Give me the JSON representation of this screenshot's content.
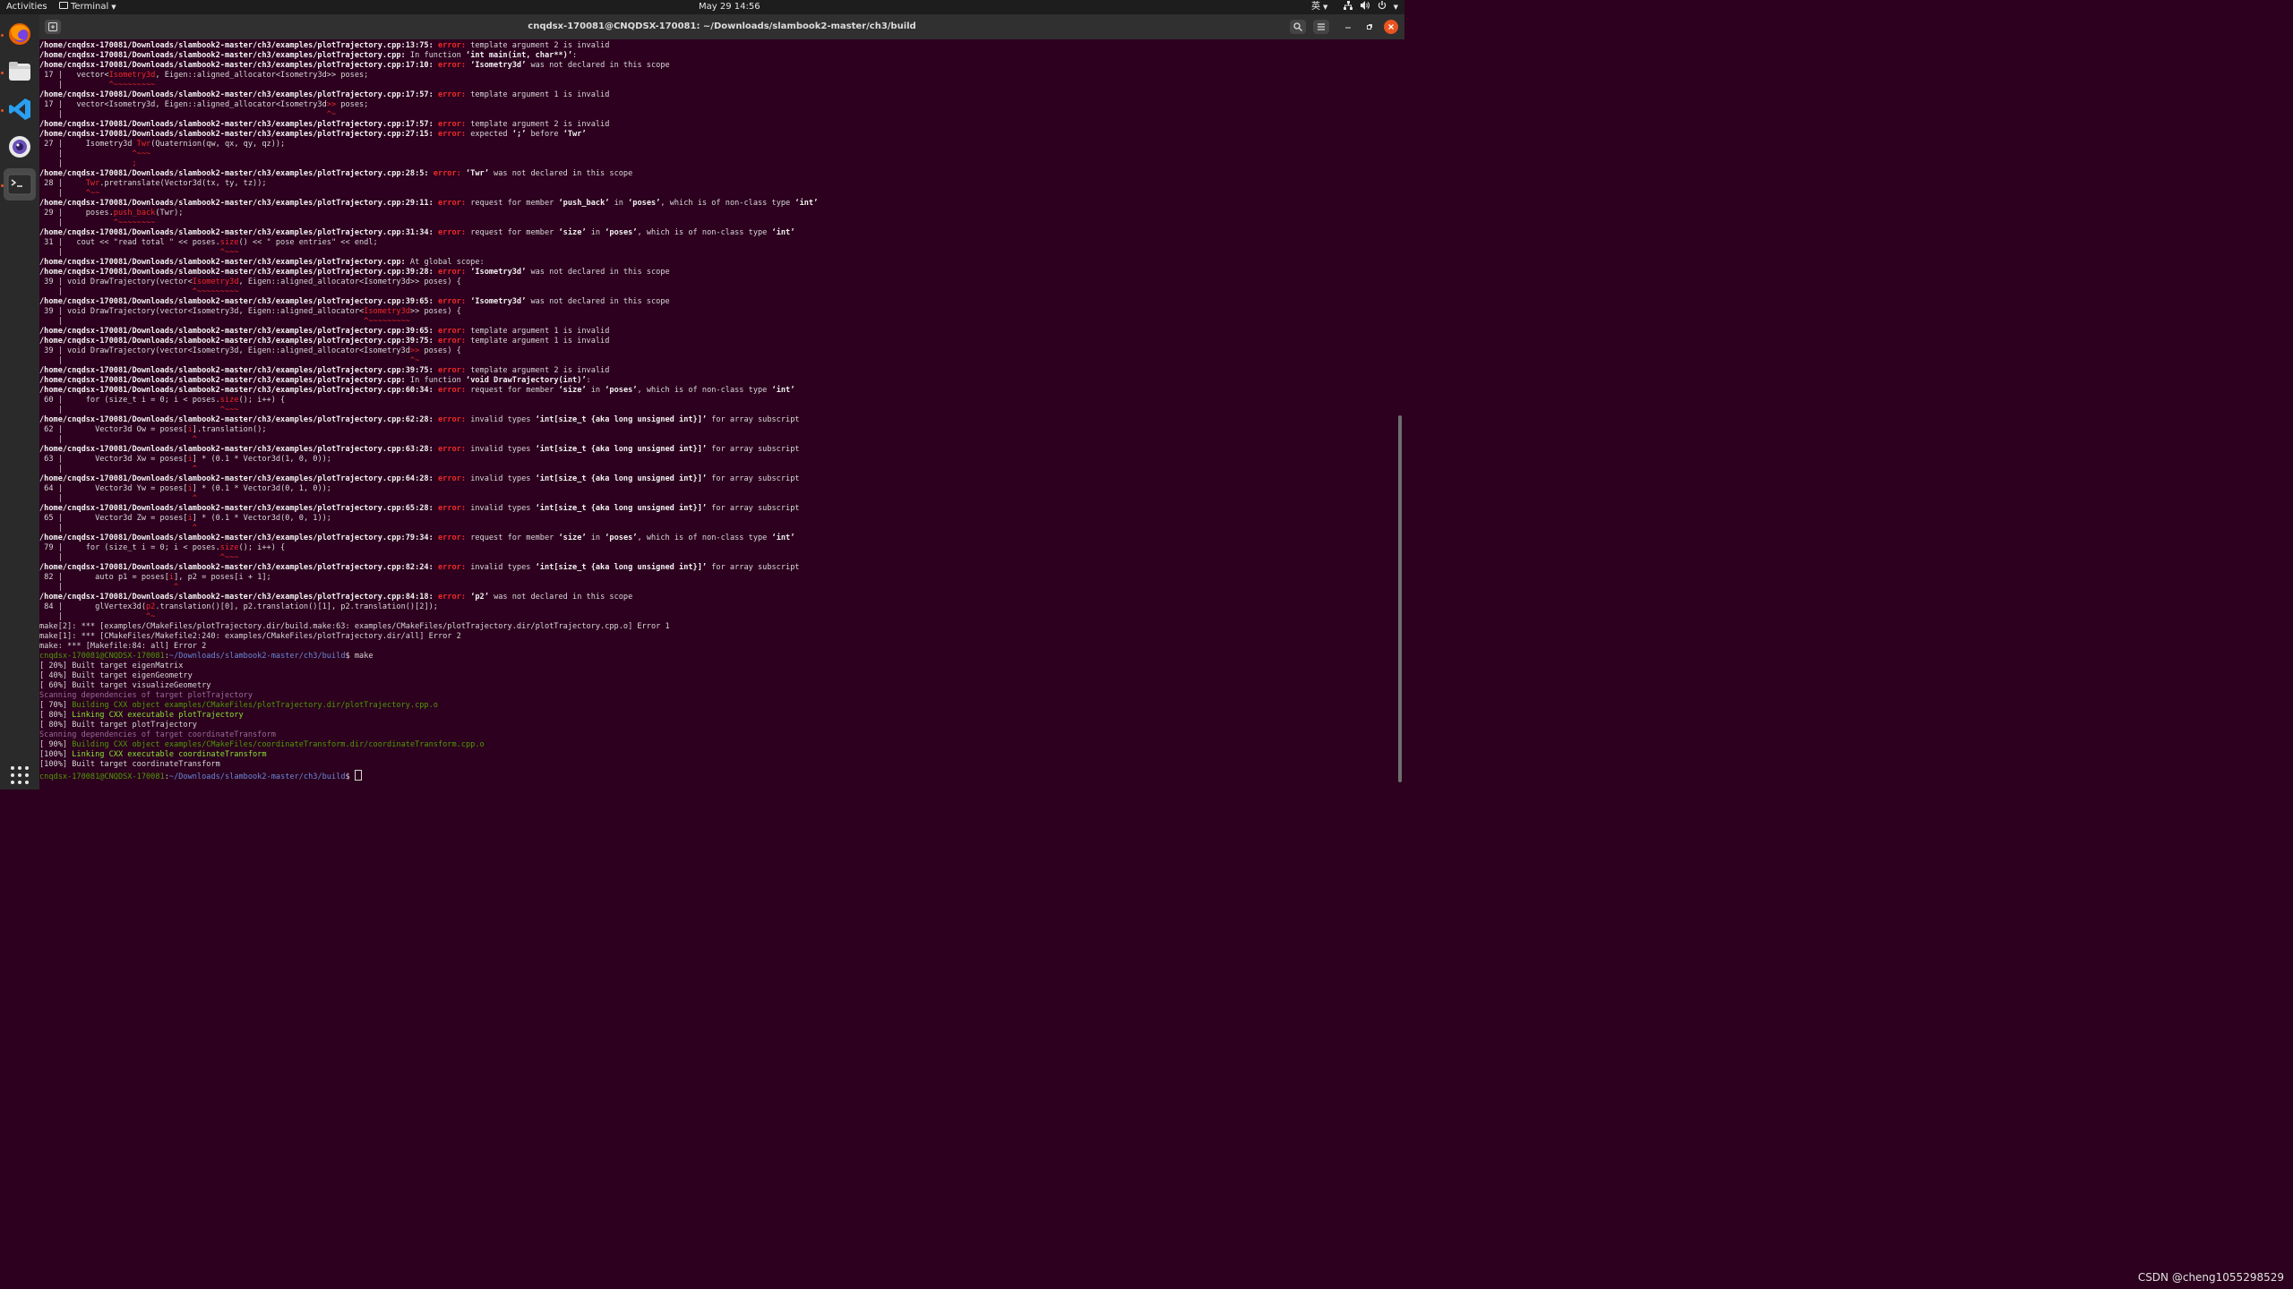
{
  "topbar": {
    "activities": "Activities",
    "app_menu": "Terminal",
    "clock": "May 29  14:56",
    "input_method": "英"
  },
  "dock": {
    "items": [
      {
        "name": "firefox-icon"
      },
      {
        "name": "files-icon"
      },
      {
        "name": "vscode-icon"
      },
      {
        "name": "camera-icon"
      },
      {
        "name": "terminal-icon"
      }
    ]
  },
  "window": {
    "title": "cnqdsx-170081@CNQDSX-170081: ~/Downloads/slambook2-master/ch3/build"
  },
  "colors": {
    "error": "#ef2929",
    "prompt_user": "#4e9a06",
    "prompt_path": "#6a8ad8",
    "build_green": "#8ae234",
    "scanning": "#9a6a9a",
    "background": "#2c001e"
  },
  "terminal": {
    "lines": [
      [
        [
          "b",
          "/home/cnqdsx-170081/Downloads/slambook2-master/ch3/examples/plotTrajectory.cpp:13:75: "
        ],
        [
          "err",
          "error: "
        ],
        [
          "",
          "template argument 2 is invalid"
        ]
      ],
      [
        [
          "b",
          "/home/cnqdsx-170081/Downloads/slambook2-master/ch3/examples/plotTrajectory.cpp:"
        ],
        [
          "",
          " In function "
        ],
        [
          "b",
          "‘int main(int, char**)’"
        ],
        [
          "",
          ":"
        ]
      ],
      [
        [
          "b",
          "/home/cnqdsx-170081/Downloads/slambook2-master/ch3/examples/plotTrajectory.cpp:17:10: "
        ],
        [
          "err",
          "error: "
        ],
        [
          "b",
          "‘Isometry3d’"
        ],
        [
          "",
          " was not declared in this scope"
        ]
      ],
      [
        [
          "",
          " 17 |   vector<"
        ],
        [
          "red",
          "Isometry3d"
        ],
        [
          "",
          ", Eigen::aligned_allocator<Isometry3d>> poses;"
        ]
      ],
      [
        [
          "",
          "    |          "
        ],
        [
          "red",
          "^~~~~~~~~~"
        ]
      ],
      [
        [
          "b",
          "/home/cnqdsx-170081/Downloads/slambook2-master/ch3/examples/plotTrajectory.cpp:17:57: "
        ],
        [
          "err",
          "error: "
        ],
        [
          "",
          "template argument 1 is invalid"
        ]
      ],
      [
        [
          "",
          " 17 |   vector<Isometry3d, Eigen::aligned_allocator<Isometry3d"
        ],
        [
          "red",
          ">>"
        ],
        [
          "",
          " poses;"
        ]
      ],
      [
        [
          "",
          "    |                                                         "
        ],
        [
          "red",
          "^~"
        ]
      ],
      [
        [
          "b",
          "/home/cnqdsx-170081/Downloads/slambook2-master/ch3/examples/plotTrajectory.cpp:17:57: "
        ],
        [
          "err",
          "error: "
        ],
        [
          "",
          "template argument 2 is invalid"
        ]
      ],
      [
        [
          "b",
          "/home/cnqdsx-170081/Downloads/slambook2-master/ch3/examples/plotTrajectory.cpp:27:15: "
        ],
        [
          "err",
          "error: "
        ],
        [
          "",
          "expected "
        ],
        [
          "b",
          "‘;’"
        ],
        [
          "",
          " before "
        ],
        [
          "b",
          "‘Twr’"
        ]
      ],
      [
        [
          "",
          " 27 |     Isometry3d "
        ],
        [
          "red",
          "Twr"
        ],
        [
          "",
          "(Quaternion(qw, qx, qy, qz));"
        ]
      ],
      [
        [
          "",
          "    |               "
        ],
        [
          "red",
          "^~~~"
        ]
      ],
      [
        [
          "",
          "    |               "
        ],
        [
          "red",
          ";"
        ]
      ],
      [
        [
          "b",
          "/home/cnqdsx-170081/Downloads/slambook2-master/ch3/examples/plotTrajectory.cpp:28:5: "
        ],
        [
          "err",
          "error: "
        ],
        [
          "b",
          "‘Twr’"
        ],
        [
          "",
          " was not declared in this scope"
        ]
      ],
      [
        [
          "",
          " 28 |     "
        ],
        [
          "red",
          "Twr"
        ],
        [
          "",
          ".pretranslate(Vector3d(tx, ty, tz));"
        ]
      ],
      [
        [
          "",
          "    |     "
        ],
        [
          "red",
          "^~~"
        ]
      ],
      [
        [
          "b",
          "/home/cnqdsx-170081/Downloads/slambook2-master/ch3/examples/plotTrajectory.cpp:29:11: "
        ],
        [
          "err",
          "error: "
        ],
        [
          "",
          "request for member "
        ],
        [
          "b",
          "‘push_back’"
        ],
        [
          "",
          " in "
        ],
        [
          "b",
          "‘poses’"
        ],
        [
          "",
          ", which is of non-class type "
        ],
        [
          "b",
          "‘int’"
        ]
      ],
      [
        [
          "",
          " 29 |     poses."
        ],
        [
          "red",
          "push_back"
        ],
        [
          "",
          "(Twr);"
        ]
      ],
      [
        [
          "",
          "    |           "
        ],
        [
          "red",
          "^~~~~~~~~"
        ]
      ],
      [
        [
          "b",
          "/home/cnqdsx-170081/Downloads/slambook2-master/ch3/examples/plotTrajectory.cpp:31:34: "
        ],
        [
          "err",
          "error: "
        ],
        [
          "",
          "request for member "
        ],
        [
          "b",
          "‘size’"
        ],
        [
          "",
          " in "
        ],
        [
          "b",
          "‘poses’"
        ],
        [
          "",
          ", which is of non-class type "
        ],
        [
          "b",
          "‘int’"
        ]
      ],
      [
        [
          "",
          " 31 |   cout << \"read total \" << poses."
        ],
        [
          "red",
          "size"
        ],
        [
          "",
          "() << \" pose entries\" << endl;"
        ]
      ],
      [
        [
          "",
          "    |                                  "
        ],
        [
          "red",
          "^~~~"
        ]
      ],
      [
        [
          "b",
          "/home/cnqdsx-170081/Downloads/slambook2-master/ch3/examples/plotTrajectory.cpp:"
        ],
        [
          "",
          " At global scope:"
        ]
      ],
      [
        [
          "b",
          "/home/cnqdsx-170081/Downloads/slambook2-master/ch3/examples/plotTrajectory.cpp:39:28: "
        ],
        [
          "err",
          "error: "
        ],
        [
          "b",
          "‘Isometry3d’"
        ],
        [
          "",
          " was not declared in this scope"
        ]
      ],
      [
        [
          "",
          " 39 | void DrawTrajectory(vector<"
        ],
        [
          "red",
          "Isometry3d"
        ],
        [
          "",
          ", Eigen::aligned_allocator<Isometry3d>> poses) {"
        ]
      ],
      [
        [
          "",
          "    |                            "
        ],
        [
          "red",
          "^~~~~~~~~~"
        ]
      ],
      [
        [
          "b",
          "/home/cnqdsx-170081/Downloads/slambook2-master/ch3/examples/plotTrajectory.cpp:39:65: "
        ],
        [
          "err",
          "error: "
        ],
        [
          "b",
          "‘Isometry3d’"
        ],
        [
          "",
          " was not declared in this scope"
        ]
      ],
      [
        [
          "",
          " 39 | void DrawTrajectory(vector<Isometry3d, Eigen::aligned_allocator<"
        ],
        [
          "red",
          "Isometry3d"
        ],
        [
          "",
          ">> poses) {"
        ]
      ],
      [
        [
          "",
          "    |                                                                 "
        ],
        [
          "red",
          "^~~~~~~~~~"
        ]
      ],
      [
        [
          "b",
          "/home/cnqdsx-170081/Downloads/slambook2-master/ch3/examples/plotTrajectory.cpp:39:65: "
        ],
        [
          "err",
          "error: "
        ],
        [
          "",
          "template argument 1 is invalid"
        ]
      ],
      [
        [
          "b",
          "/home/cnqdsx-170081/Downloads/slambook2-master/ch3/examples/plotTrajectory.cpp:39:75: "
        ],
        [
          "err",
          "error: "
        ],
        [
          "",
          "template argument 1 is invalid"
        ]
      ],
      [
        [
          "",
          " 39 | void DrawTrajectory(vector<Isometry3d, Eigen::aligned_allocator<Isometry3d"
        ],
        [
          "red",
          ">>"
        ],
        [
          "",
          " poses) {"
        ]
      ],
      [
        [
          "",
          "    |                                                                           "
        ],
        [
          "red",
          "^~"
        ]
      ],
      [
        [
          "b",
          "/home/cnqdsx-170081/Downloads/slambook2-master/ch3/examples/plotTrajectory.cpp:39:75: "
        ],
        [
          "err",
          "error: "
        ],
        [
          "",
          "template argument 2 is invalid"
        ]
      ],
      [
        [
          "b",
          "/home/cnqdsx-170081/Downloads/slambook2-master/ch3/examples/plotTrajectory.cpp:"
        ],
        [
          "",
          " In function "
        ],
        [
          "b",
          "‘void DrawTrajectory(int)’"
        ],
        [
          "",
          ":"
        ]
      ],
      [
        [
          "b",
          "/home/cnqdsx-170081/Downloads/slambook2-master/ch3/examples/plotTrajectory.cpp:60:34: "
        ],
        [
          "err",
          "error: "
        ],
        [
          "",
          "request for member "
        ],
        [
          "b",
          "‘size’"
        ],
        [
          "",
          " in "
        ],
        [
          "b",
          "‘poses’"
        ],
        [
          "",
          ", which is of non-class type "
        ],
        [
          "b",
          "‘int’"
        ]
      ],
      [
        [
          "",
          " 60 |     for (size_t i = 0; i < poses."
        ],
        [
          "red",
          "size"
        ],
        [
          "",
          "(); i++) {"
        ]
      ],
      [
        [
          "",
          "    |                                  "
        ],
        [
          "red",
          "^~~~"
        ]
      ],
      [
        [
          "b",
          "/home/cnqdsx-170081/Downloads/slambook2-master/ch3/examples/plotTrajectory.cpp:62:28: "
        ],
        [
          "err",
          "error: "
        ],
        [
          "",
          "invalid types "
        ],
        [
          "b",
          "‘int[size_t {aka long unsigned int}]’"
        ],
        [
          "",
          " for array subscript"
        ]
      ],
      [
        [
          "",
          " 62 |       Vector3d Ow = poses["
        ],
        [
          "red",
          "i"
        ],
        [
          "",
          "].translation();"
        ]
      ],
      [
        [
          "",
          "    |                            "
        ],
        [
          "red",
          "^"
        ]
      ],
      [
        [
          "b",
          "/home/cnqdsx-170081/Downloads/slambook2-master/ch3/examples/plotTrajectory.cpp:63:28: "
        ],
        [
          "err",
          "error: "
        ],
        [
          "",
          "invalid types "
        ],
        [
          "b",
          "‘int[size_t {aka long unsigned int}]’"
        ],
        [
          "",
          " for array subscript"
        ]
      ],
      [
        [
          "",
          " 63 |       Vector3d Xw = poses["
        ],
        [
          "red",
          "i"
        ],
        [
          "",
          "] * (0.1 * Vector3d(1, 0, 0));"
        ]
      ],
      [
        [
          "",
          "    |                            "
        ],
        [
          "red",
          "^"
        ]
      ],
      [
        [
          "b",
          "/home/cnqdsx-170081/Downloads/slambook2-master/ch3/examples/plotTrajectory.cpp:64:28: "
        ],
        [
          "err",
          "error: "
        ],
        [
          "",
          "invalid types "
        ],
        [
          "b",
          "‘int[size_t {aka long unsigned int}]’"
        ],
        [
          "",
          " for array subscript"
        ]
      ],
      [
        [
          "",
          " 64 |       Vector3d Yw = poses["
        ],
        [
          "red",
          "i"
        ],
        [
          "",
          "] * (0.1 * Vector3d(0, 1, 0));"
        ]
      ],
      [
        [
          "",
          "    |                            "
        ],
        [
          "red",
          "^"
        ]
      ],
      [
        [
          "b",
          "/home/cnqdsx-170081/Downloads/slambook2-master/ch3/examples/plotTrajectory.cpp:65:28: "
        ],
        [
          "err",
          "error: "
        ],
        [
          "",
          "invalid types "
        ],
        [
          "b",
          "‘int[size_t {aka long unsigned int}]’"
        ],
        [
          "",
          " for array subscript"
        ]
      ],
      [
        [
          "",
          " 65 |       Vector3d Zw = poses["
        ],
        [
          "red",
          "i"
        ],
        [
          "",
          "] * (0.1 * Vector3d(0, 0, 1));"
        ]
      ],
      [
        [
          "",
          "    |                            "
        ],
        [
          "red",
          "^"
        ]
      ],
      [
        [
          "b",
          "/home/cnqdsx-170081/Downloads/slambook2-master/ch3/examples/plotTrajectory.cpp:79:34: "
        ],
        [
          "err",
          "error: "
        ],
        [
          "",
          "request for member "
        ],
        [
          "b",
          "‘size’"
        ],
        [
          "",
          " in "
        ],
        [
          "b",
          "‘poses’"
        ],
        [
          "",
          ", which is of non-class type "
        ],
        [
          "b",
          "‘int’"
        ]
      ],
      [
        [
          "",
          " 79 |     for (size_t i = 0; i < poses."
        ],
        [
          "red",
          "size"
        ],
        [
          "",
          "(); i++) {"
        ]
      ],
      [
        [
          "",
          "    |                                  "
        ],
        [
          "red",
          "^~~~"
        ]
      ],
      [
        [
          "b",
          "/home/cnqdsx-170081/Downloads/slambook2-master/ch3/examples/plotTrajectory.cpp:82:24: "
        ],
        [
          "err",
          "error: "
        ],
        [
          "",
          "invalid types "
        ],
        [
          "b",
          "‘int[size_t {aka long unsigned int}]’"
        ],
        [
          "",
          " for array subscript"
        ]
      ],
      [
        [
          "",
          " 82 |       auto p1 = poses["
        ],
        [
          "red",
          "i"
        ],
        [
          "",
          "], p2 = poses[i + 1];"
        ]
      ],
      [
        [
          "",
          "    |                        "
        ],
        [
          "red",
          "^"
        ]
      ],
      [
        [
          "b",
          "/home/cnqdsx-170081/Downloads/slambook2-master/ch3/examples/plotTrajectory.cpp:84:18: "
        ],
        [
          "err",
          "error: "
        ],
        [
          "b",
          "‘p2’"
        ],
        [
          "",
          " was not declared in this scope"
        ]
      ],
      [
        [
          "",
          " 84 |       glVertex3d("
        ],
        [
          "red",
          "p2"
        ],
        [
          "",
          ".translation()[0], p2.translation()[1], p2.translation()[2]);"
        ]
      ],
      [
        [
          "",
          "    |                  "
        ],
        [
          "red",
          "^~"
        ]
      ],
      [
        [
          "",
          "make[2]: *** [examples/CMakeFiles/plotTrajectory.dir/build.make:63: examples/CMakeFiles/plotTrajectory.dir/plotTrajectory.cpp.o] Error 1"
        ]
      ],
      [
        [
          "",
          "make[1]: *** [CMakeFiles/Makefile2:240: examples/CMakeFiles/plotTrajectory.dir/all] Error 2"
        ]
      ],
      [
        [
          "",
          "make: *** [Makefile:84: all] Error 2"
        ]
      ],
      [
        [
          "pgrn",
          "cnqdsx-170081@CNQDSX-170081"
        ],
        [
          "",
          ":"
        ],
        [
          "blu",
          "~/Downloads/slambook2-master/ch3/build"
        ],
        [
          "",
          "$ make"
        ]
      ],
      [
        [
          "",
          "[ 20%] Built target eigenMatrix"
        ]
      ],
      [
        [
          "",
          "[ 40%] Built target eigenGeometry"
        ]
      ],
      [
        [
          "",
          "[ 60%] Built target visualizeGeometry"
        ]
      ],
      [
        [
          "mag",
          "Scanning dependencies of target plotTrajectory"
        ]
      ],
      [
        [
          "",
          "[ 70%] "
        ],
        [
          "pgrn",
          "Building CXX object examples/CMakeFiles/plotTrajectory.dir/plotTrajectory.cpp.o"
        ]
      ],
      [
        [
          "",
          "[ 80%] "
        ],
        [
          "grn",
          "Linking CXX executable plotTrajectory"
        ]
      ],
      [
        [
          "",
          "[ 80%] Built target plotTrajectory"
        ]
      ],
      [
        [
          "mag",
          "Scanning dependencies of target coordinateTransform"
        ]
      ],
      [
        [
          "",
          "[ 90%] "
        ],
        [
          "pgrn",
          "Building CXX object examples/CMakeFiles/coordinateTransform.dir/coordinateTransform.cpp.o"
        ]
      ],
      [
        [
          "",
          "[100%] "
        ],
        [
          "grn",
          "Linking CXX executable coordinateTransform"
        ]
      ],
      [
        [
          "",
          "[100%] Built target coordinateTransform"
        ]
      ],
      [
        [
          "pgrn",
          "cnqdsx-170081@CNQDSX-170081"
        ],
        [
          "",
          ":"
        ],
        [
          "blu",
          "~/Downloads/slambook2-master/ch3/build"
        ],
        [
          "",
          "$ "
        ]
      ]
    ]
  },
  "watermark": "CSDN @cheng1055298529"
}
